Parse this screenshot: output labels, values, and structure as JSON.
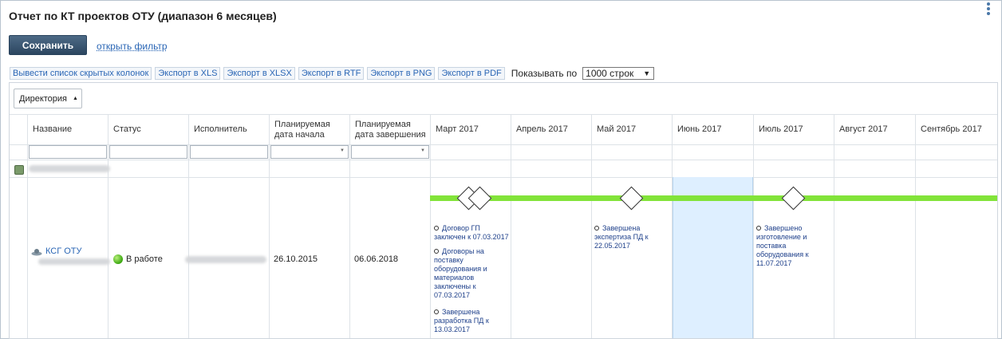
{
  "title": "Отчет по КТ проектов ОТУ (диапазон 6 месяцев)",
  "save_label": "Сохранить",
  "filter_link": "открыть фильтр",
  "toolbar": {
    "hidden_cols": "Вывести список скрытых колонок",
    "xls": "Экспорт в XLS",
    "xlsx": "Экспорт в XLSX",
    "rtf": "Экспорт в RTF",
    "png": "Экспорт в PNG",
    "pdf": "Экспорт в PDF",
    "show_label": "Показывать по",
    "rows_value": "1000 строк"
  },
  "grouping": {
    "label": "Директория"
  },
  "columns": {
    "name": "Название",
    "status": "Статус",
    "executor": "Исполнитель",
    "plan_start": "Планируемая дата начала",
    "plan_end": "Планируемая дата завершения",
    "months": [
      "Март 2017",
      "Апрель 2017",
      "Май 2017",
      "Июнь 2017",
      "Июль 2017",
      "Август 2017",
      "Сентябрь 2017"
    ]
  },
  "row": {
    "project": "КСГ ОТУ",
    "status": "В работе",
    "start_date": "26.10.2015",
    "end_date": "06.06.2018"
  },
  "milestones": {
    "march": [
      "Договор ГП заключен к 07.03.2017",
      "Договоры на поставку оборудования и материалов заключены к 07.03.2017",
      "Завершена разработка ПД к 13.03.2017"
    ],
    "may": [
      "Завершена экспертиза ПД к 22.05.2017"
    ],
    "july": [
      "Завершено изготовление и поставка оборудования к 11.07.2017"
    ]
  },
  "colors": {
    "timeline": "#82e339",
    "highlight_month": "#deefff",
    "accent": "#2a66b5"
  }
}
